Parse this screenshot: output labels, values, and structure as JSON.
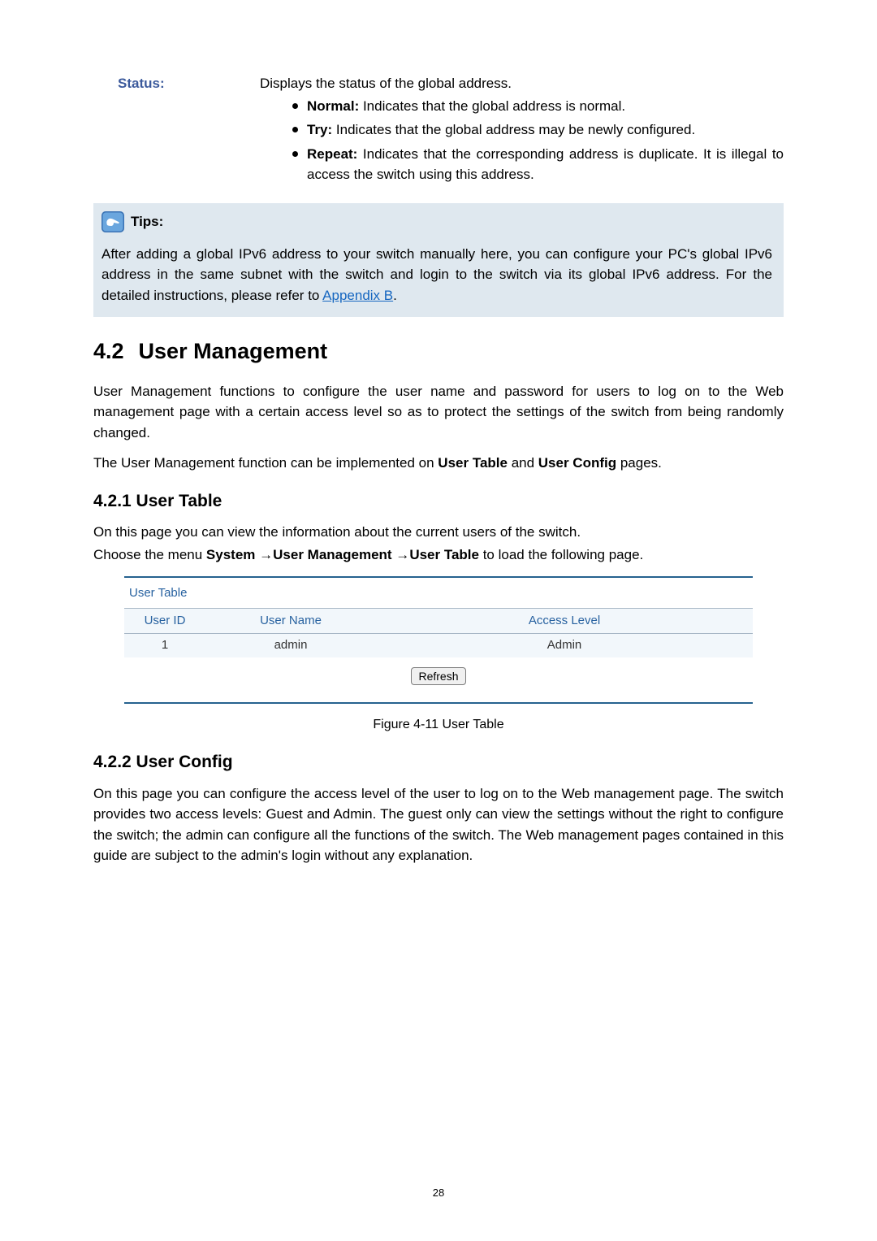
{
  "status": {
    "label": "Status:",
    "desc": "Displays the status of the global address.",
    "items": [
      {
        "term": "Normal:",
        "text": " Indicates that the global address is normal."
      },
      {
        "term": "Try:",
        "text": " Indicates that the global address may be newly configured."
      },
      {
        "term": "Repeat:",
        "text": " Indicates that the corresponding address is duplicate. It is illegal to access the switch using this address."
      }
    ]
  },
  "tips": {
    "label": "Tips:",
    "text_part1": "After adding a global IPv6 address to your switch manually here, you can configure your PC's global IPv6 address in the same subnet with the switch and login to the switch via its global IPv6 address. For the detailed instructions, please refer to ",
    "link": "Appendix B",
    "text_part2": "."
  },
  "sec42": {
    "num": "4.2",
    "title": "User Management",
    "p1": "User Management functions to configure the user name and password for users to log on to the Web management page with a certain access level so as to protect the settings of the switch from being randomly changed.",
    "p2_pre": "The User Management function can be implemented on ",
    "p2_bold1": "User Table",
    "p2_mid": " and ",
    "p2_bold2": "User Config",
    "p2_post": " pages."
  },
  "sec421": {
    "title": "4.2.1 User Table",
    "p1": "On this page you can view the information about the current users of the switch.",
    "p2_pre": "Choose the menu ",
    "p2_b1": "System",
    "p2_arrow": " →",
    "p2_b2": "User Management",
    "p2_b3": "User Table",
    "p2_post": " to load the following page."
  },
  "user_table": {
    "panel_title": "User Table",
    "headers": {
      "id": "User ID",
      "name": "User Name",
      "level": "Access Level"
    },
    "rows": [
      {
        "id": "1",
        "name": "admin",
        "level": "Admin"
      }
    ],
    "refresh_label": "Refresh",
    "figure_caption": "Figure 4-11 User Table"
  },
  "sec422": {
    "title": "4.2.2 User Config",
    "p1": "On this page you can configure the access level of the user to log on to the Web management page. The switch provides two access levels: Guest and Admin. The guest only can view the settings without the right to configure the switch; the admin can configure all the functions of the switch. The Web management pages contained in this guide are subject to the admin's login without any explanation."
  },
  "page_number": "28"
}
